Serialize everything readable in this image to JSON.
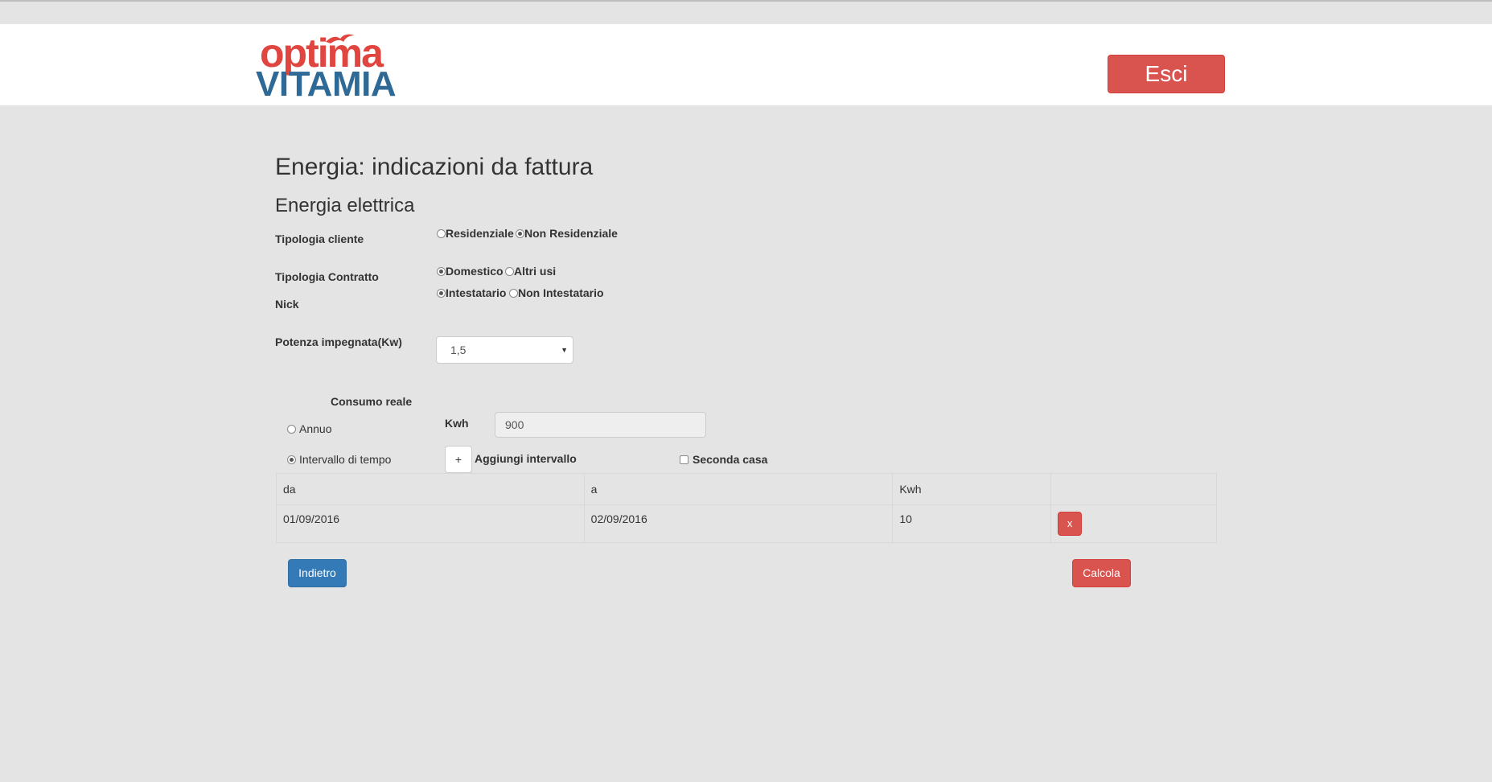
{
  "brand": {
    "logo_top": "optima",
    "logo_bottom": "VITAMIA"
  },
  "header": {
    "logout_label": "Esci"
  },
  "page": {
    "title": "Energia: indicazioni da fattura",
    "subtitle": "Energia elettrica"
  },
  "form": {
    "tipologia_cliente": {
      "label": "Tipologia cliente",
      "options": [
        "Residenziale",
        "Non Residenziale"
      ],
      "selected": "Non Residenziale"
    },
    "tipologia_contratto": {
      "label": "Tipologia Contratto",
      "options": [
        "Domestico",
        "Altri usi"
      ],
      "selected": "Domestico"
    },
    "nick": {
      "label": "Nick",
      "options": [
        "Intestatario",
        "Non Intestatario"
      ],
      "selected": "Intestatario"
    },
    "potenza": {
      "label": "Potenza impegnata(Kw)",
      "value": "1,5"
    },
    "consumo": {
      "heading": "Consumo reale",
      "annuo_label": "Annuo",
      "intervallo_label": "Intervallo di tempo",
      "selected": "Intervallo di tempo",
      "kwh_label": "Kwh",
      "kwh_value": "900",
      "add_button": "+",
      "add_label": "Aggiungi intervallo",
      "seconda_casa_label": "Seconda casa",
      "seconda_casa_checked": false
    }
  },
  "table": {
    "headers": [
      "da",
      "a",
      "Kwh",
      ""
    ],
    "rows": [
      {
        "da": "01/09/2016",
        "a": "02/09/2016",
        "kwh": "10",
        "remove": "x"
      }
    ]
  },
  "actions": {
    "back_label": "Indietro",
    "calc_label": "Calcola"
  },
  "colors": {
    "danger": "#d9534f",
    "primary": "#337ab7",
    "brand_red": "#e0463f",
    "brand_blue": "#2f6a96",
    "background": "#e4e4e4"
  }
}
